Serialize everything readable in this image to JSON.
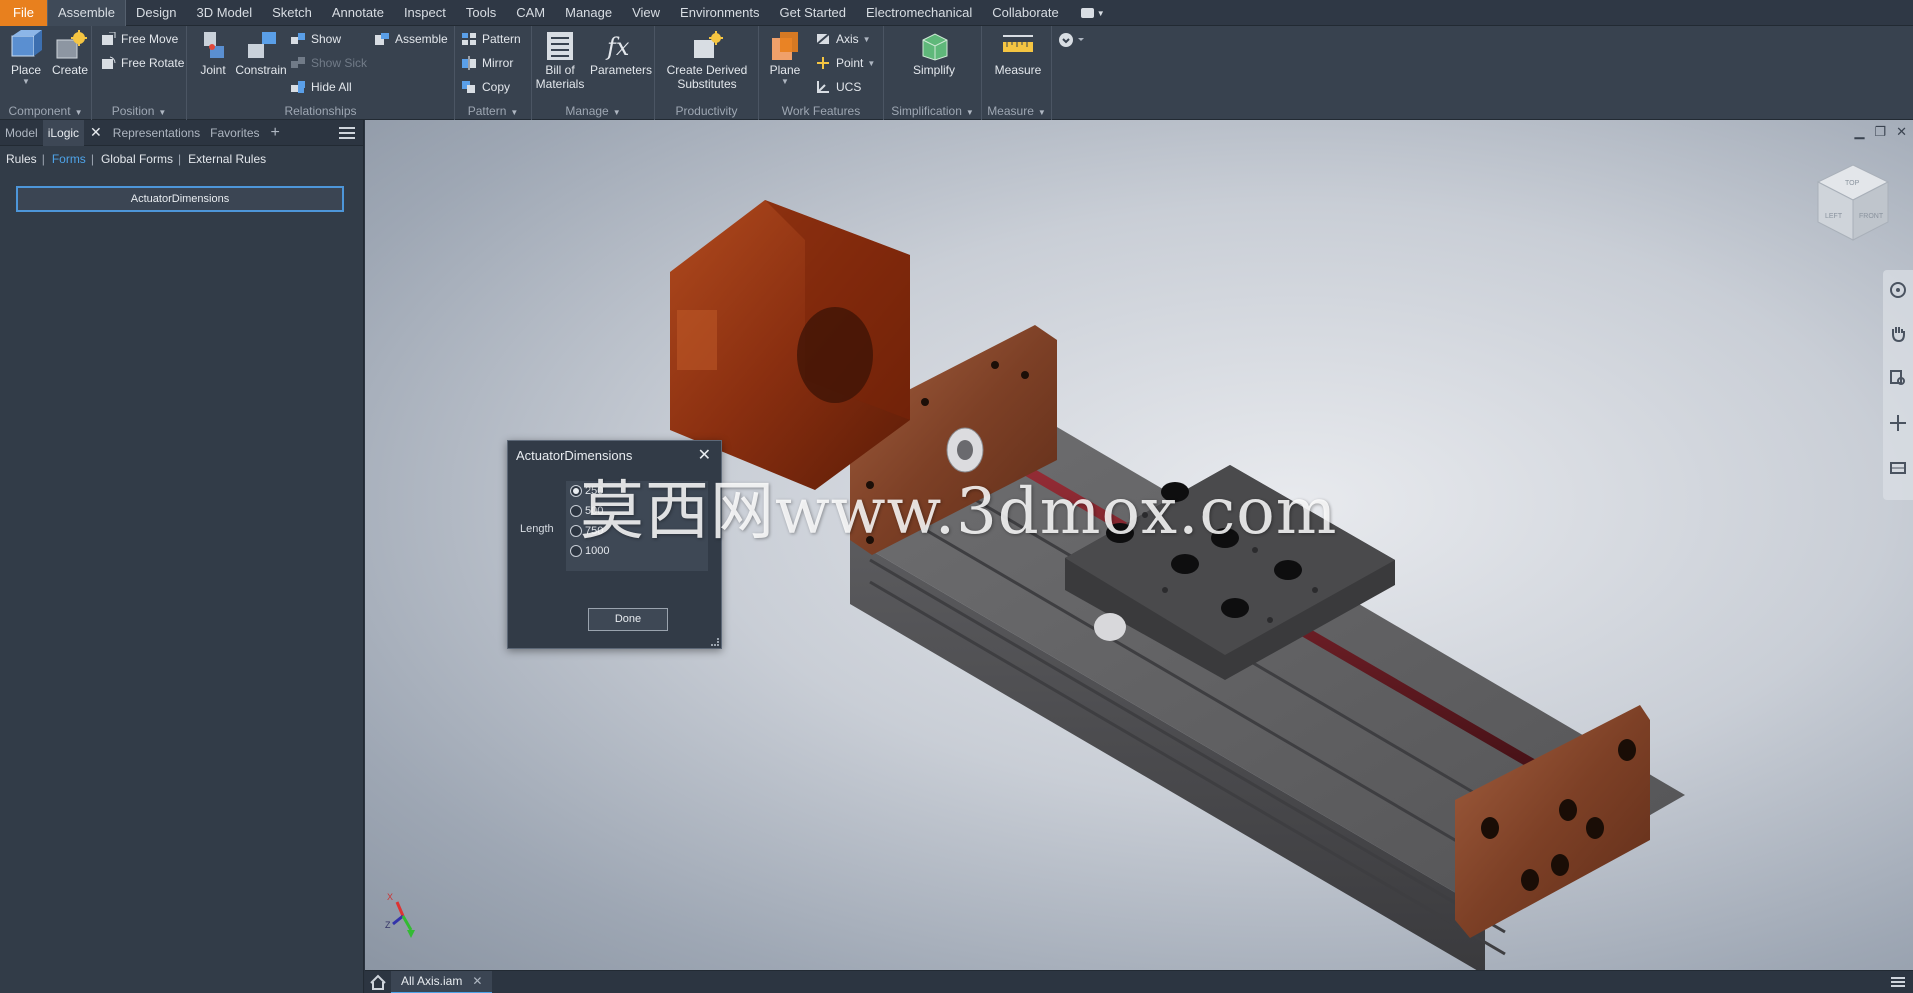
{
  "menu": {
    "tabs": [
      "File",
      "Assemble",
      "Design",
      "3D Model",
      "Sketch",
      "Annotate",
      "Inspect",
      "Tools",
      "CAM",
      "Manage",
      "View",
      "Environments",
      "Get Started",
      "Electromechanical",
      "Collaborate"
    ],
    "active": "Assemble"
  },
  "ribbon": {
    "component": {
      "label": "Component",
      "place": "Place",
      "create": "Create"
    },
    "position": {
      "label": "Position",
      "free_move": "Free Move",
      "free_rotate": "Free Rotate"
    },
    "relationships": {
      "label": "Relationships",
      "joint": "Joint",
      "constrain": "Constrain",
      "show": "Show",
      "show_sick": "Show Sick",
      "hide_all": "Hide All",
      "assemble": "Assemble"
    },
    "pattern": {
      "label": "Pattern",
      "pattern": "Pattern",
      "mirror": "Mirror",
      "copy": "Copy"
    },
    "manage": {
      "label": "Manage",
      "bom_line1": "Bill of",
      "bom_line2": "Materials",
      "parameters": "Parameters"
    },
    "productivity": {
      "label": "Productivity",
      "cds_line1": "Create Derived",
      "cds_line2": "Substitutes"
    },
    "work_features": {
      "label": "Work Features",
      "plane": "Plane",
      "axis": "Axis",
      "point": "Point",
      "ucs": "UCS"
    },
    "simplification": {
      "label": "Simplification",
      "simplify": "Simplify"
    },
    "measure": {
      "label": "Measure",
      "measure": "Measure"
    }
  },
  "browser": {
    "tabs": [
      "Model",
      "iLogic",
      "Representations",
      "Favorites"
    ],
    "active_tab": "iLogic",
    "links": [
      "Rules",
      "Forms",
      "Global Forms",
      "External Rules"
    ],
    "selected_link": "Forms",
    "form_button": "ActuatorDimensions"
  },
  "dialog": {
    "title": "ActuatorDimensions",
    "field_label": "Length",
    "options": [
      "250",
      "500",
      "750",
      "1000"
    ],
    "selected": "250",
    "done": "Done"
  },
  "document": {
    "tab": "All Axis.iam"
  },
  "watermark": "莫西网www.3dmox.com",
  "viewcube": {
    "top": "TOP",
    "left": "LEFT",
    "front": "FRONT"
  },
  "triad": {
    "x": "X",
    "z": "Z"
  },
  "colors": {
    "file_tab": "#e8801e",
    "accent": "#4ea3e8",
    "ribbon_bg": "#38424f"
  }
}
